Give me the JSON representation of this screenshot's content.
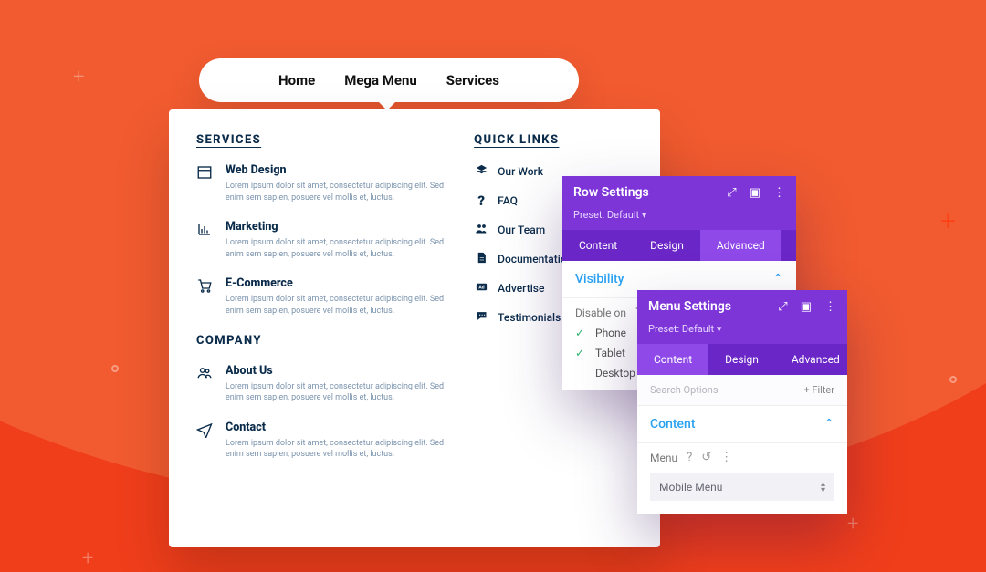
{
  "nav": {
    "items": [
      "Home",
      "Mega Menu",
      "Services"
    ]
  },
  "mega": {
    "services_heading": "SERVICES",
    "company_heading": "COMPANY",
    "quicklinks_heading": "QUICK LINKS",
    "lorem": "Lorem ipsum dolor sit amet, consectetur adipiscing elit. Sed enim sem sapien, posuere vel mollis et, luctus.",
    "services": [
      {
        "icon": "window",
        "title": "Web Design"
      },
      {
        "icon": "chart",
        "title": "Marketing"
      },
      {
        "icon": "cart",
        "title": "E-Commerce"
      }
    ],
    "company": [
      {
        "icon": "people",
        "title": "About Us"
      },
      {
        "icon": "plane",
        "title": "Contact"
      }
    ],
    "quicklinks": [
      {
        "icon": "layers",
        "label": "Our Work"
      },
      {
        "icon": "help",
        "label": "FAQ"
      },
      {
        "icon": "team",
        "label": "Our Team"
      },
      {
        "icon": "doc",
        "label": "Documentation"
      },
      {
        "icon": "ad",
        "label": "Advertise"
      },
      {
        "icon": "chat",
        "label": "Testimonials"
      }
    ]
  },
  "panel1": {
    "title": "Row Settings",
    "preset": "Preset: Default ▾",
    "tabs": [
      "Content",
      "Design",
      "Advanced"
    ],
    "active_tab": 2,
    "section": "Visibility",
    "disable_label": "Disable on",
    "options": [
      {
        "label": "Phone",
        "checked": true
      },
      {
        "label": "Tablet",
        "checked": true
      },
      {
        "label": "Desktop",
        "checked": false
      }
    ]
  },
  "panel2": {
    "title": "Menu Settings",
    "preset": "Preset: Default ▾",
    "tabs": [
      "Content",
      "Design",
      "Advanced"
    ],
    "active_tab": 0,
    "search_placeholder": "Search Options",
    "filter_label": "+ Filter",
    "section": "Content",
    "field_label": "Menu",
    "field_value": "Mobile Menu"
  },
  "icons": {
    "expand": "⤢",
    "box": "▣",
    "more": "⋮",
    "help": "?",
    "undo": "↺"
  }
}
